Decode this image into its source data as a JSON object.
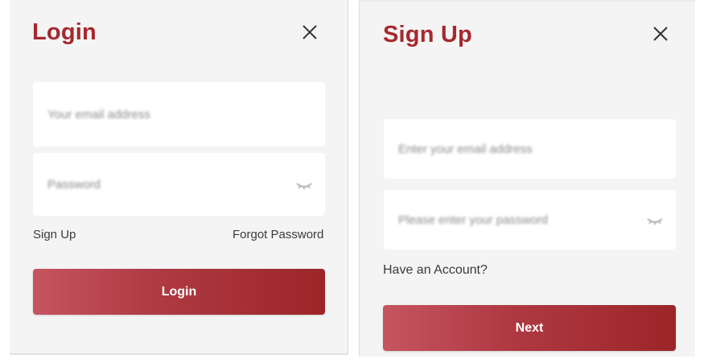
{
  "login": {
    "title": "Login",
    "email_placeholder": "Your email address",
    "password_placeholder": "Password",
    "signup_link": "Sign Up",
    "forgot_link": "Forgot Password",
    "submit_label": "Login"
  },
  "signup": {
    "title": "Sign Up",
    "email_placeholder": "Enter your email address",
    "password_placeholder": "Please enter your password",
    "have_account_link": "Have an Account?",
    "submit_label": "Next"
  },
  "colors": {
    "accent": "#a5292e",
    "button_start": "#c55560",
    "button_end": "#9c2528",
    "panel_bg": "#f4f4f4"
  },
  "icons": [
    "close-icon",
    "eye-off-icon"
  ]
}
